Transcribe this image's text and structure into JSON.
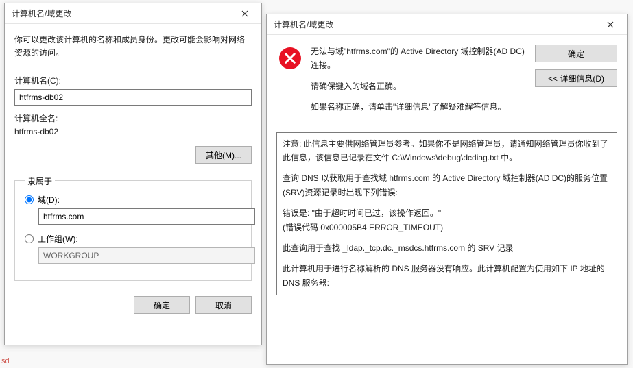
{
  "left": {
    "title": "计算机名/域更改",
    "description": "你可以更改该计算机的名称和成员身份。更改可能会影响对网络资源的访问。",
    "computer_name_label": "计算机名(C):",
    "computer_name_value": "htfrms-db02",
    "full_name_label": "计算机全名:",
    "full_name_value": "htfrms-db02",
    "more_button": "其他(M)...",
    "member_of_legend": "隶属于",
    "domain_radio_label": "域(D):",
    "domain_value": "htfrms.com",
    "workgroup_radio_label": "工作组(W):",
    "workgroup_value": "WORKGROUP",
    "ok_button": "确定",
    "cancel_button": "取消"
  },
  "right": {
    "title": "计算机名/域更改",
    "error_line1": "无法与域\"htfrms.com\"的 Active Directory 域控制器(AD DC)连接。",
    "error_line2": "请确保键入的域名正确。",
    "error_line3": "如果名称正确，请单击\"详细信息\"了解疑难解答信息。",
    "ok_button": "确定",
    "details_button": "<< 详细信息(D)",
    "details": {
      "p1": "注意: 此信息主要供网络管理员参考。如果你不是网络管理员，请通知网络管理员你收到了此信息，该信息已记录在文件 C:\\Windows\\debug\\dcdiag.txt 中。",
      "p2": "查询 DNS 以获取用于查找域 htfrms.com 的 Active Directory 域控制器(AD DC)的服务位置(SRV)资源记录时出现下列错误:",
      "p3": "错误是: \"由于超时时间已过，该操作返回。\"\n(错误代码 0x000005B4 ERROR_TIMEOUT)",
      "p4": "此查询用于查找 _ldap._tcp.dc._msdcs.htfrms.com 的 SRV 记录",
      "p5": "此计算机用于进行名称解析的 DNS 服务器没有响应。此计算机配置为使用如下 IP 地址的 DNS 服务器:"
    }
  },
  "watermarks": {
    "bl": "sd"
  }
}
